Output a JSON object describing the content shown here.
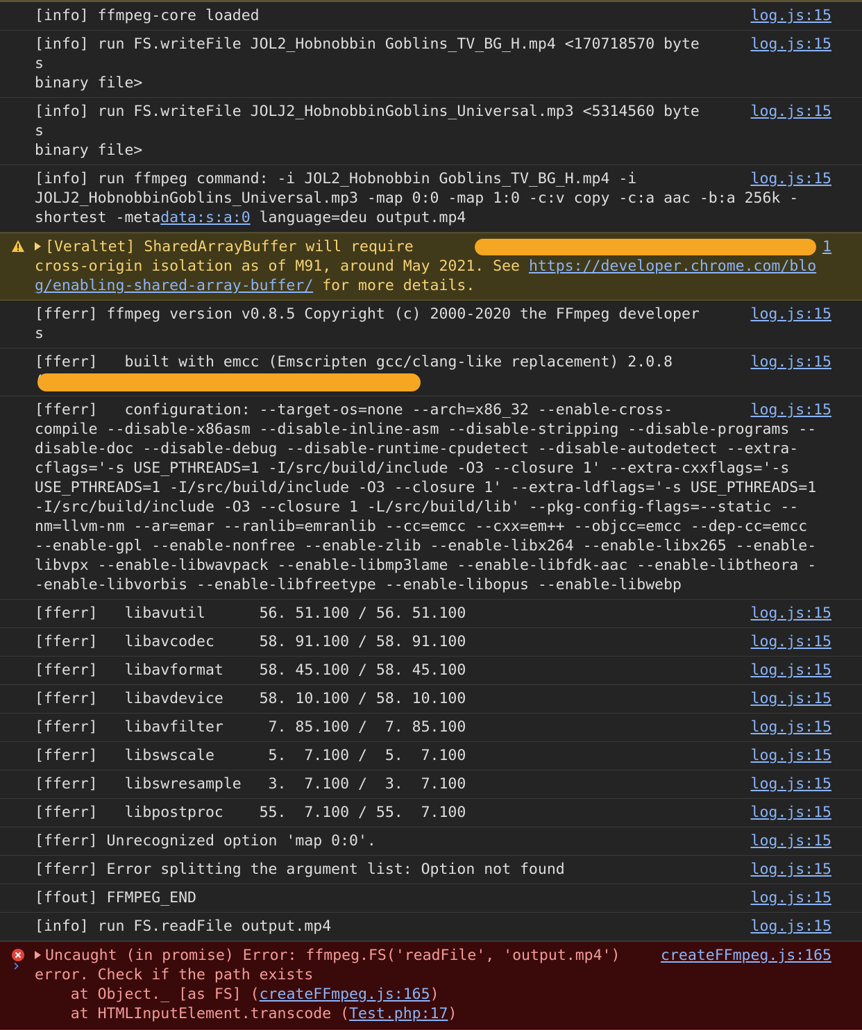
{
  "rows": [
    {
      "msg": "[info] ffmpeg-core loaded",
      "src": "log.js:15"
    },
    {
      "msg": "[info] run FS.writeFile JOL2_Hobnobbin Goblins_TV_BG_H.mp4 <170718570 bytes\nbinary file>",
      "src": "log.js:15"
    },
    {
      "msg": "[info] run FS.writeFile JOLJ2_HobnobbinGoblins_Universal.mp3 <5314560 bytes\nbinary file>",
      "src": "log.js:15"
    },
    {
      "msg_a": "[info] run ffmpeg command: -i JOL2_Hobnobbin Goblins_TV_BG_H.mp4 -i\nJOLJ2_HobnobbinGoblins_Universal.mp3 -map 0:0 -map 1:0 -c:v copy -c:a aac -b:a 256k -\nshortest -meta",
      "msg_link": "data:s:a:0",
      "msg_b": " language=deu output.mp4",
      "src": "log.js:15"
    }
  ],
  "warning": {
    "msg_a": "[Veraltet] SharedArrayBuffer will require",
    "msg_b": "cross-origin isolation as of M91, around May 2021. See ",
    "link": "https://developer.chrome.com/blog/enabling-shared-array-buffer/",
    "msg_c": " for more details.",
    "src_end": "1"
  },
  "rows2": [
    {
      "msg": "[fferr] ffmpeg version v0.8.5 Copyright (c) 2000-2020 the FFmpeg developers",
      "src": "log.js:15"
    },
    {
      "msg": "[fferr]   built with emcc (Emscripten gcc/clang-like replacement) 2.0.8\n(",
      "src": "log.js:15"
    },
    {
      "msg": "[fferr]   configuration: --target-os=none --arch=x86_32 --enable-cross-\ncompile --disable-x86asm --disable-inline-asm --disable-stripping --disable-programs --\ndisable-doc --disable-debug --disable-runtime-cpudetect --disable-autodetect --extra-\ncflags='-s USE_PTHREADS=1 -I/src/build/include -O3 --closure 1' --extra-cxxflags='-s\nUSE_PTHREADS=1 -I/src/build/include -O3 --closure 1' --extra-ldflags='-s USE_PTHREADS=1\n-I/src/build/include -O3 --closure 1 -L/src/build/lib' --pkg-config-flags=--static --\nnm=llvm-nm --ar=emar --ranlib=emranlib --cc=emcc --cxx=em++ --objcc=emcc --dep-cc=emcc\n--enable-gpl --enable-nonfree --enable-zlib --enable-libx264 --enable-libx265 --enable-\nlibvpx --enable-libwavpack --enable-libmp3lame --enable-libfdk-aac --enable-libtheora -\n-enable-libvorbis --enable-libfreetype --enable-libopus --enable-libwebp",
      "src": "log.js:15"
    },
    {
      "msg": "[fferr]   libavutil      56. 51.100 / 56. 51.100",
      "src": "log.js:15"
    },
    {
      "msg": "[fferr]   libavcodec     58. 91.100 / 58. 91.100",
      "src": "log.js:15"
    },
    {
      "msg": "[fferr]   libavformat    58. 45.100 / 58. 45.100",
      "src": "log.js:15"
    },
    {
      "msg": "[fferr]   libavdevice    58. 10.100 / 58. 10.100",
      "src": "log.js:15"
    },
    {
      "msg": "[fferr]   libavfilter     7. 85.100 /  7. 85.100",
      "src": "log.js:15"
    },
    {
      "msg": "[fferr]   libswscale      5.  7.100 /  5.  7.100",
      "src": "log.js:15"
    },
    {
      "msg": "[fferr]   libswresample   3.  7.100 /  3.  7.100",
      "src": "log.js:15"
    },
    {
      "msg": "[fferr]   libpostproc    55.  7.100 / 55.  7.100",
      "src": "log.js:15"
    },
    {
      "msg": "[fferr] Unrecognized option 'map 0:0'.",
      "src": "log.js:15"
    },
    {
      "msg": "[fferr] Error splitting the argument list: Option not found",
      "src": "log.js:15"
    },
    {
      "msg": "[ffout] FFMPEG_END",
      "src": "log.js:15"
    },
    {
      "msg": "[info] run FS.readFile output.mp4",
      "src": "log.js:15"
    }
  ],
  "error": {
    "line1": "Uncaught (in promise) Error: ffmpeg.FS('readFile', 'output.mp4')",
    "line2": "error. Check if the path exists",
    "at1_a": "    at Object._ [as FS] (",
    "at1_link": "createFFmpeg.js:165",
    "at1_b": ")",
    "at2_a": "    at HTMLInputElement.transcode (",
    "at2_link": "Test.php:17",
    "at2_b": ")",
    "src": "createFFmpeg.js:165"
  },
  "prompt": "›",
  "colors": {
    "background": "#242424",
    "link": "#8ab4f8",
    "warning_bg": "#413a1a",
    "error_bg": "#3a0a0a",
    "redaction": "#f5a623"
  }
}
